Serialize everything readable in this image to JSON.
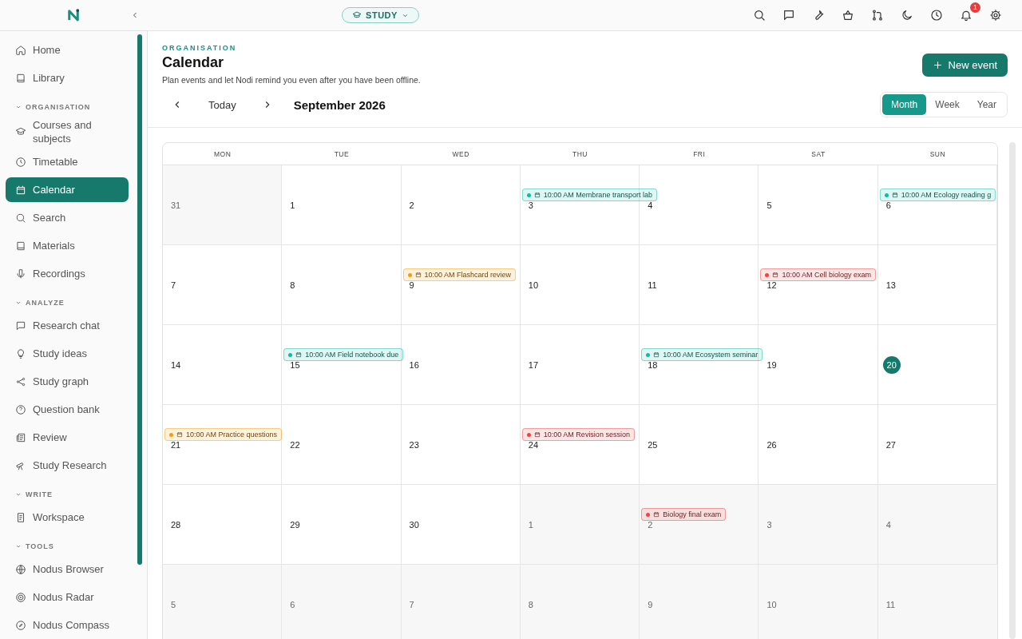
{
  "topbar": {
    "mode": "STUDY",
    "notification_count": "1"
  },
  "sidebar": {
    "items": [
      {
        "label": "Home",
        "selected": false
      },
      {
        "label": "Library",
        "selected": false
      }
    ],
    "sections": [
      {
        "title": "ORGANISATION",
        "expanded": true,
        "items": [
          {
            "label": "Courses and subjects",
            "selected": false
          },
          {
            "label": "Timetable",
            "selected": false
          },
          {
            "label": "Calendar",
            "selected": true
          },
          {
            "label": "Search",
            "selected": false
          },
          {
            "label": "Materials",
            "selected": false
          },
          {
            "label": "Recordings",
            "selected": false
          }
        ]
      },
      {
        "title": "ANALYZE",
        "expanded": true,
        "items": [
          {
            "label": "Research chat",
            "selected": false
          },
          {
            "label": "Study ideas",
            "selected": false
          },
          {
            "label": "Study graph",
            "selected": false
          },
          {
            "label": "Question bank",
            "selected": false
          },
          {
            "label": "Review",
            "selected": false
          },
          {
            "label": "Study Research",
            "selected": false
          }
        ]
      },
      {
        "title": "WRITE",
        "expanded": true,
        "items": [
          {
            "label": "Workspace",
            "selected": false
          }
        ]
      },
      {
        "title": "TOOLS",
        "expanded": true,
        "items": [
          {
            "label": "Nodus Browser",
            "selected": false
          },
          {
            "label": "Nodus Radar",
            "selected": false
          },
          {
            "label": "Nodus Compass",
            "selected": false
          }
        ]
      }
    ]
  },
  "header": {
    "eyebrow": "ORGANISATION",
    "title": "Calendar",
    "description": "Plan events and let Nodi remind you even after you have been offline.",
    "new_event": "New event"
  },
  "toolbar": {
    "today": "Today",
    "month_label": "September 2026",
    "views": [
      {
        "label": "Month",
        "selected": true
      },
      {
        "label": "Week",
        "selected": false
      },
      {
        "label": "Year",
        "selected": false
      }
    ]
  },
  "calendar": {
    "weekdays": [
      "MON",
      "TUE",
      "WED",
      "THU",
      "FRI",
      "SAT",
      "SUN"
    ],
    "weeks": [
      {
        "days": [
          {
            "date": "31",
            "in_month": false,
            "today": false
          },
          {
            "date": "1",
            "in_month": true,
            "today": false
          },
          {
            "date": "2",
            "in_month": true,
            "today": false
          },
          {
            "date": "3",
            "in_month": true,
            "today": false,
            "events": [
              {
                "label": "10:00 AM Membrane transport lab",
                "color": "#14b8a6"
              }
            ]
          },
          {
            "date": "4",
            "in_month": true,
            "today": false
          },
          {
            "date": "5",
            "in_month": true,
            "today": false
          },
          {
            "date": "6",
            "in_month": true,
            "today": false,
            "events": [
              {
                "label": "10:00 AM Ecology reading g",
                "color": "#14b8a6"
              }
            ]
          }
        ]
      },
      {
        "days": [
          {
            "date": "7",
            "in_month": true,
            "today": false
          },
          {
            "date": "8",
            "in_month": true,
            "today": false
          },
          {
            "date": "9",
            "in_month": true,
            "today": false,
            "events": [
              {
                "label": "10:00 AM Flashcard review",
                "color": "#f59e0b"
              }
            ]
          },
          {
            "date": "10",
            "in_month": true,
            "today": false
          },
          {
            "date": "11",
            "in_month": true,
            "today": false
          },
          {
            "date": "12",
            "in_month": true,
            "today": false,
            "events": [
              {
                "label": "10:00 AM Cell biology exam",
                "color": "#ef4444"
              }
            ]
          },
          {
            "date": "13",
            "in_month": true,
            "today": false
          }
        ]
      },
      {
        "days": [
          {
            "date": "14",
            "in_month": true,
            "today": false
          },
          {
            "date": "15",
            "in_month": true,
            "today": false,
            "events": [
              {
                "label": "10:00 AM Field notebook due",
                "color": "#14b8a6"
              }
            ]
          },
          {
            "date": "16",
            "in_month": true,
            "today": false
          },
          {
            "date": "17",
            "in_month": true,
            "today": false
          },
          {
            "date": "18",
            "in_month": true,
            "today": false,
            "events": [
              {
                "label": "10:00 AM Ecosystem seminar",
                "color": "#14b8a6"
              }
            ]
          },
          {
            "date": "19",
            "in_month": true,
            "today": false
          },
          {
            "date": "20",
            "in_month": true,
            "today": true
          }
        ]
      },
      {
        "days": [
          {
            "date": "21",
            "in_month": true,
            "today": false,
            "events": [
              {
                "label": "10:00 AM Practice questions",
                "color": "#f59e0b"
              }
            ]
          },
          {
            "date": "22",
            "in_month": true,
            "today": false
          },
          {
            "date": "23",
            "in_month": true,
            "today": false
          },
          {
            "date": "24",
            "in_month": true,
            "today": false,
            "events": [
              {
                "label": "10:00 AM Revision session",
                "color": "#ef4444"
              }
            ]
          },
          {
            "date": "25",
            "in_month": true,
            "today": false
          },
          {
            "date": "26",
            "in_month": true,
            "today": false
          },
          {
            "date": "27",
            "in_month": true,
            "today": false
          }
        ]
      },
      {
        "days": [
          {
            "date": "28",
            "in_month": true,
            "today": false
          },
          {
            "date": "29",
            "in_month": true,
            "today": false
          },
          {
            "date": "30",
            "in_month": true,
            "today": false
          },
          {
            "date": "1",
            "in_month": false,
            "today": false
          },
          {
            "date": "2",
            "in_month": false,
            "today": false,
            "events": [
              {
                "label": "Biology final exam",
                "color": "#ef4444"
              }
            ]
          },
          {
            "date": "3",
            "in_month": false,
            "today": false
          },
          {
            "date": "4",
            "in_month": false,
            "today": false
          }
        ]
      },
      {
        "days": [
          {
            "date": "5",
            "in_month": false,
            "today": false
          },
          {
            "date": "6",
            "in_month": false,
            "today": false
          },
          {
            "date": "7",
            "in_month": false,
            "today": false
          },
          {
            "date": "8",
            "in_month": false,
            "today": false
          },
          {
            "date": "9",
            "in_month": false,
            "today": false
          },
          {
            "date": "10",
            "in_month": false,
            "today": false
          },
          {
            "date": "11",
            "in_month": false,
            "today": false
          }
        ]
      }
    ]
  }
}
